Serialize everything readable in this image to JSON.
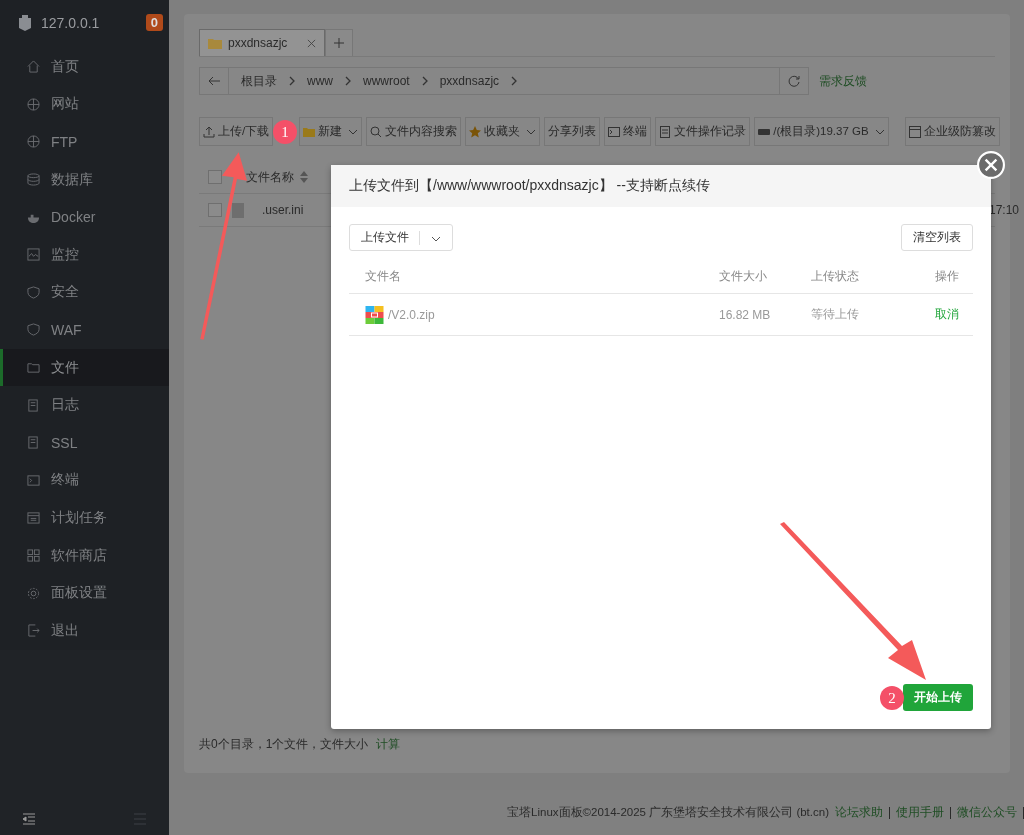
{
  "sidebar": {
    "host": "127.0.0.1",
    "badge": "0",
    "items": [
      {
        "label": "首页",
        "kind": "home",
        "selected": false
      },
      {
        "label": "网站",
        "kind": "globe",
        "selected": false
      },
      {
        "label": "FTP",
        "kind": "globe",
        "selected": false
      },
      {
        "label": "数据库",
        "kind": "database",
        "selected": false
      },
      {
        "label": "Docker",
        "kind": "docker",
        "selected": false
      },
      {
        "label": "监控",
        "kind": "monitor",
        "selected": false
      },
      {
        "label": "安全",
        "kind": "shield",
        "selected": false
      },
      {
        "label": "WAF",
        "kind": "shield",
        "selected": false
      },
      {
        "label": "文件",
        "kind": "folder",
        "selected": true
      },
      {
        "label": "日志",
        "kind": "doc",
        "selected": false
      },
      {
        "label": "SSL",
        "kind": "doc",
        "selected": false
      },
      {
        "label": "终端",
        "kind": "terminal",
        "selected": false
      },
      {
        "label": "计划任务",
        "kind": "calendar",
        "selected": false
      },
      {
        "label": "软件商店",
        "kind": "grid",
        "selected": false
      },
      {
        "label": "面板设置",
        "kind": "gear",
        "selected": false
      },
      {
        "label": "退出",
        "kind": "exit",
        "selected": false
      }
    ]
  },
  "tabs": [
    {
      "label": "pxxdnsazjc",
      "selected": true
    }
  ],
  "breadcrumb": [
    "根目录",
    "www",
    "wwwroot",
    "pxxdnsazjc"
  ],
  "feedback": "需求反馈",
  "toolbar": [
    {
      "label": "上传/下载",
      "kind": "upload",
      "dropdown": false
    },
    {
      "label": "新建",
      "kind": "folder",
      "dropdown": true
    },
    {
      "label": "文件内容搜索",
      "kind": "search",
      "dropdown": false
    },
    {
      "label": "收藏夹",
      "kind": "star",
      "dropdown": true
    },
    {
      "label": "分享列表",
      "kind": "none",
      "dropdown": false
    },
    {
      "label": "终端",
      "kind": "terminal",
      "dropdown": false
    },
    {
      "label": "文件操作记录",
      "kind": "doc",
      "dropdown": false
    },
    {
      "label": "/(根目录)19.37 GB",
      "kind": "disk",
      "dropdown": true
    },
    {
      "label": "企业级防篡改",
      "kind": "lock",
      "dropdown": false
    }
  ],
  "table": {
    "all_checked": false,
    "columns": [
      "文件名称"
    ],
    "rows": [
      {
        "name": ".user.ini",
        "time": "17:10",
        "checked": false
      }
    ]
  },
  "summary": "共0个目录，1个文件，文件大小",
  "calc_link": "计算",
  "dialog": {
    "title": "上传文件到【/www/wwwroot/pxxdnsazjc】 --支持断点续传",
    "upload_button": "上传文件",
    "clear_button": "清空列表",
    "columns": [
      "文件名",
      "文件大小",
      "上传状态",
      "操作"
    ],
    "files": [
      {
        "name": "/V2.0.zip",
        "size": "16.82 MB",
        "status": "等待上传",
        "action": "取消"
      }
    ],
    "start_button": "开始上传"
  },
  "footer": {
    "text": "宝塔Linux面板©2014-2025 广东堡塔安全技术有限公司 (bt.cn)",
    "links": [
      "论坛求助",
      "使用手册",
      "微信公众号"
    ]
  },
  "annotations": [
    {
      "number": "1"
    },
    {
      "number": "2"
    }
  ]
}
